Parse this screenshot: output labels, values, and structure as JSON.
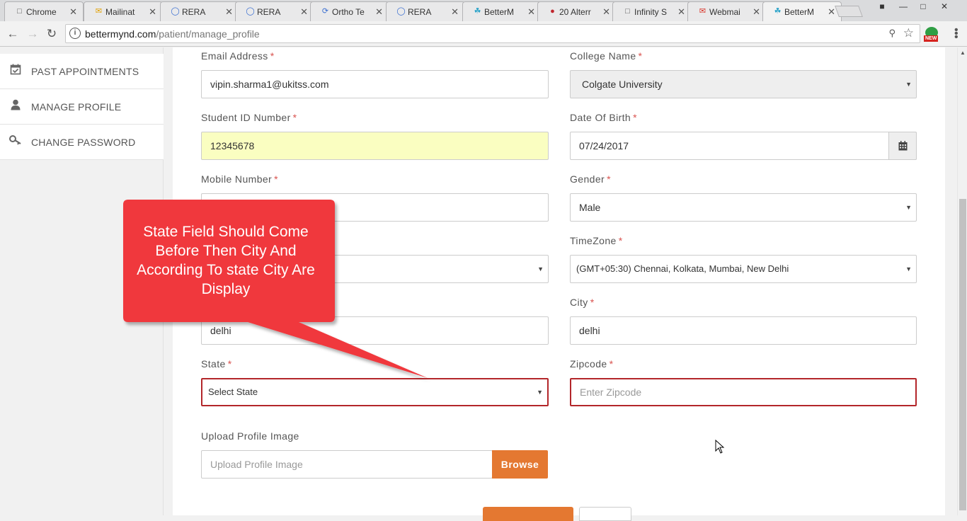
{
  "browser": {
    "tabs": [
      {
        "title": "Chrome",
        "icon": "page-icon"
      },
      {
        "title": "Mailinat",
        "icon": "mail-favicon"
      },
      {
        "title": "RERA",
        "icon": "globe-icon"
      },
      {
        "title": "RERA",
        "icon": "globe-icon"
      },
      {
        "title": "Ortho Te",
        "icon": "spinner-icon"
      },
      {
        "title": "RERA",
        "icon": "globe-icon"
      },
      {
        "title": "BetterM",
        "icon": "bettermynd-favicon"
      },
      {
        "title": "20 Alterr",
        "icon": "red-favicon"
      },
      {
        "title": "Infinity S",
        "icon": "page-icon"
      },
      {
        "title": "Webmai",
        "icon": "gmail-icon"
      },
      {
        "title": "BetterM",
        "icon": "bettermynd-favicon"
      }
    ],
    "url_host": "bettermynd.com",
    "url_path": "/patient/manage_profile",
    "extension_badge": "NEW"
  },
  "sidebar": {
    "items": [
      {
        "label": "PAST APPOINTMENTS",
        "icon": "calendar-check-icon"
      },
      {
        "label": "MANAGE PROFILE",
        "icon": "user-icon"
      },
      {
        "label": "CHANGE PASSWORD",
        "icon": "key-icon"
      }
    ]
  },
  "form": {
    "email": {
      "label": "Email Address",
      "value": "vipin.sharma1@ukitss.com"
    },
    "college": {
      "label": "College Name",
      "value": "Colgate University"
    },
    "student_id": {
      "label": "Student ID Number",
      "value": "12345678"
    },
    "dob": {
      "label": "Date Of Birth",
      "value": "07/24/2017"
    },
    "mobile": {
      "label": "Mobile Number",
      "value": ""
    },
    "gender": {
      "label": "Gender",
      "value": "Male"
    },
    "timezone": {
      "label": "TimeZone",
      "value": "(GMT+05:30) Chennai, Kolkata, Mumbai, New Delhi"
    },
    "address": {
      "value": "delhi"
    },
    "city": {
      "label": "City",
      "value": "delhi"
    },
    "state": {
      "label": "State",
      "value": "Select State"
    },
    "zipcode": {
      "label": "Zipcode",
      "placeholder": "Enter Zipcode"
    },
    "upload": {
      "label": "Upload Profile Image",
      "placeholder": "Upload Profile Image",
      "button": "Browse"
    },
    "required_mark": "*"
  },
  "callout": {
    "text": "State Field Should Come Before Then City And According To state City Are Display",
    "color": "#f0383d"
  },
  "colors": {
    "accent": "#e47831",
    "error_border": "#b3262a",
    "required": "#d9534f"
  }
}
